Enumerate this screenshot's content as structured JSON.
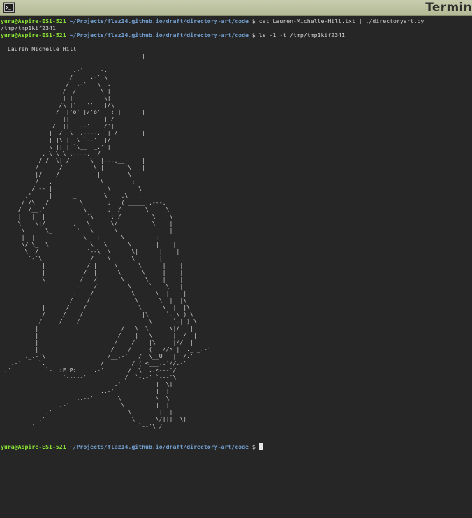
{
  "window": {
    "title": "Termin",
    "icon": "terminal-icon"
  },
  "prompt": {
    "user_host": "yura@Aspire-ES1-521",
    "path": "~/Projects/flaz14.github.io/draft/directory-art/code",
    "symbol": "$"
  },
  "lines": [
    {
      "command": "cat Lauren-Michelle-Hill.txt | ./directoryart.py"
    },
    {
      "output": "/tmp/tmp1kif2341"
    },
    {
      "command": "ls -1 -t /tmp/tmp1kif2341"
    }
  ],
  "art": {
    "caption": "  Lauren Michelle Hill",
    "body": "                                         |\n                        ____            |\n                     .-'    `-.         |\n                    /   __.-' \\         |\n                   /  .-'   \\  .        |\n                  /  /       \\ |        |\n                  | |  __  __ \\|        |\n                 /\\ |'   ''   |/\\       |\n                /  |'o' |/'o'   ; |      |\n               |  ||          | /       |\n               /  ||   --'    /'|       |\n              |  /  \\  .----.  | /       |\n              | |\\ |  \\ `--'  |/        |\n              \\ || | `\\__  _.' |        |\n            .'\\|\\ \\ .----.  /           |\n           / / |\\| /      \\  |---.__     |\n          /      /         \\ |      `\\   |\n          |/    /           |        \\  |\n          /   .'             \\        :\n         / --'|                \\        \\\n       .'     |      _        \\    .\\   :\n      / /\\   /         \\       :   ( _____..---.\n     /  /__.'           \\      :  /       \\     \\\n     |   |  |            `\\     : /         \\    \\\n     \\    \\|/|       ;   \\      \\/          \\    |\n      \\      \\_       '   \\      \\          |    |\n      |  |   |          \\   :      \\         :\n      \\/ \\_  \\            \\   \\      \\       |    |\n       \\  /              `--\\  \\      \\|      |    |\n        `-`\\              /    \\      \\       |\n            |            / |     \\      \\      |    |\n            |           /  |      \\      \\     |    |\n            \\          /   /       \\      \\    |    |\n             |        .    /         \\     `.   \\   |\n             |       .    /           \\      \\  |    |\n             |      /    /             \\      \\  |  |\\\n            |      /    /               \\      \\  |  |\\\n            /     /    /                 |\\     `. \\ ) \\\n           /     /    /                 |  \\      `.| ) \\\n          |                        /   \\  \\      \\|/   |\n          |                       /    |   \\      |  /  |\n          |                      /    /    |\\     |//  |\n          |                     /    /     (   //> |  ._ _.-'\n       ._.-'\\                  /__.-'   /  \\__U   |  /.'\n   .-'     `.                /        / ( <___..'//.-'\n .'          `-._:F_P:  ___.-'       /  \\  ..<---'/\n                  `-----'          _/  `-.-' `---'\\\n                                 .'          |  \\|\n                           __..-'            |  |\n                    __..--'       \\          \\  \\\n               __.-'               \\         |  |\n             .'                      \\        |  |\n          _.'                         \\      \\/|||  \\|\n         '                              `--'\\_/"
  }
}
